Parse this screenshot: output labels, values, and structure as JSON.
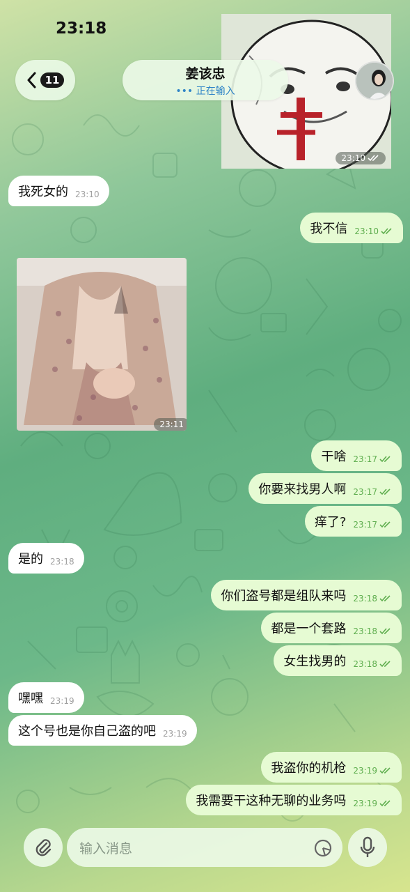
{
  "status_bar": {
    "time": "23:18"
  },
  "header": {
    "back_badge": "11",
    "contact_name": "姜该忠",
    "contact_status": "正在输入"
  },
  "messages": [
    {
      "id": "m0",
      "dir": "out",
      "kind": "sticker",
      "time": "23:10"
    },
    {
      "id": "m1",
      "dir": "in",
      "text": "我死女的",
      "time": "23:10"
    },
    {
      "id": "m2",
      "dir": "out",
      "text": "我不信",
      "time": "23:10"
    },
    {
      "id": "m3",
      "dir": "in",
      "kind": "photo",
      "time": "23:11"
    },
    {
      "id": "m4",
      "dir": "out",
      "text": "干啥",
      "time": "23:17"
    },
    {
      "id": "m5",
      "dir": "out",
      "text": "你要来找男人啊",
      "time": "23:17"
    },
    {
      "id": "m6",
      "dir": "out",
      "text": "痒了?",
      "time": "23:17"
    },
    {
      "id": "m7",
      "dir": "in",
      "text": "是的",
      "time": "23:18"
    },
    {
      "id": "m8",
      "dir": "out",
      "text": "你们盗号都是组队来吗",
      "time": "23:18"
    },
    {
      "id": "m9",
      "dir": "out",
      "text": "都是一个套路",
      "time": "23:18"
    },
    {
      "id": "m10",
      "dir": "out",
      "text": "女生找男的",
      "time": "23:18"
    },
    {
      "id": "m11",
      "dir": "in",
      "text": "嘿嘿",
      "time": "23:19"
    },
    {
      "id": "m12",
      "dir": "in",
      "text": "这个号也是你自己盗的吧",
      "time": "23:19"
    },
    {
      "id": "m13",
      "dir": "out",
      "text": "我盗你的机枪",
      "time": "23:19"
    },
    {
      "id": "m14",
      "dir": "out",
      "text": "我需要干这种无聊的业务吗",
      "time": "23:19"
    }
  ],
  "composer": {
    "placeholder": "输入消息"
  },
  "colors": {
    "incoming_bubble": "#ffffff",
    "outgoing_bubble": "#e6fbd3",
    "outgoing_time": "#5fae4f",
    "typing_status": "#2f84c7"
  },
  "icons": [
    "back-chevron-icon",
    "paperclip-icon",
    "sticker-icon",
    "microphone-icon",
    "double-check-icon",
    "signal-icon",
    "wifi-icon",
    "battery-icon"
  ]
}
